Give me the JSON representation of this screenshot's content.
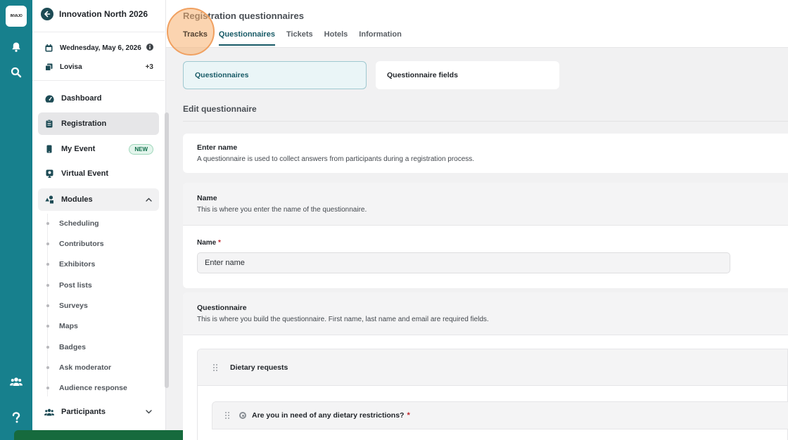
{
  "rail": {
    "logo_text": "INVAJO"
  },
  "sidebar": {
    "event_name": "Innovation North 2026",
    "date": "Wednesday, May 6, 2026",
    "owner": "Lovisa",
    "owner_extra": "+3",
    "nav": [
      {
        "label": "Dashboard"
      },
      {
        "label": "Registration"
      },
      {
        "label": "My Event",
        "badge": "NEW"
      },
      {
        "label": "Virtual Event"
      },
      {
        "label": "Modules"
      }
    ],
    "modules": [
      "Scheduling",
      "Contributors",
      "Exhibitors",
      "Post lists",
      "Surveys",
      "Maps",
      "Badges",
      "Ask moderator",
      "Audience response"
    ],
    "participants": "Participants"
  },
  "header": {
    "title": "Registration questionnaires",
    "tabs": [
      "Tracks",
      "Questionnaires",
      "Tickets",
      "Hotels",
      "Information"
    ],
    "active_tab": "Questionnaires"
  },
  "subtabs": [
    "Questionnaires",
    "Questionnaire fields"
  ],
  "section_title": "Edit questionnaire",
  "intro": {
    "title": "Enter name",
    "description": "A questionnaire is used to collect answers from participants during a registration process."
  },
  "name_card": {
    "title": "Name",
    "description": "This is where you enter the name of the questionnaire.",
    "field_label": "Name",
    "required_mark": "*",
    "value": "Enter name"
  },
  "questionnaire_card": {
    "title": "Questionnaire",
    "description": "This is where you build the questionnaire. First name, last name and email are required fields.",
    "group_title": "Dietary requests",
    "question": "Are you in need of any dietary restrictions?",
    "required_mark": "*"
  },
  "colors": {
    "rail": "#17808d",
    "accent": "#175a66",
    "highlight": "#f0a060"
  }
}
